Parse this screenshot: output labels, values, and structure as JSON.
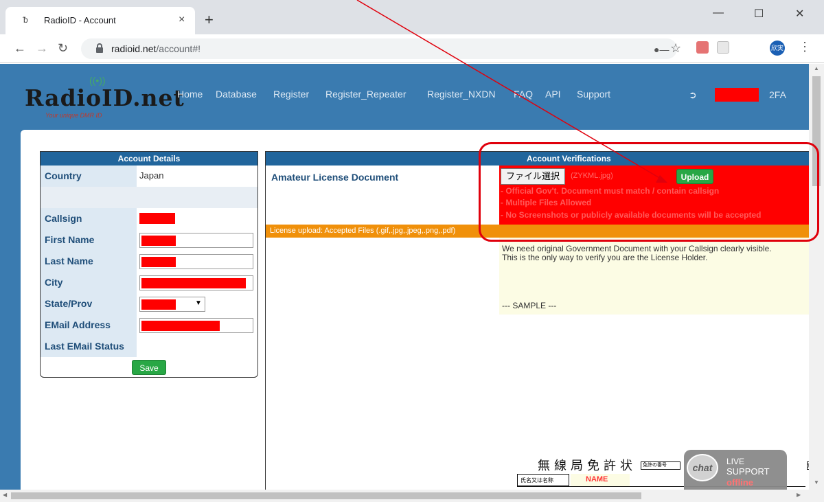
{
  "browser": {
    "tab_title": "RadioID - Account",
    "tab_close": "×",
    "new_tab": "+",
    "url_host": "radioid.net",
    "url_path": "/account#!",
    "avatar_text": "欣実",
    "window_controls": {
      "minimize": "—",
      "maximize": "☐",
      "close": "✕"
    }
  },
  "site": {
    "logo_text": "RadioID.net",
    "logo_tagline": "Your unique DMR ID",
    "nav": [
      "Home",
      "Database",
      "Register",
      "Register_Repeater",
      "Register_NXDN",
      "FAQ",
      "API",
      "Support"
    ],
    "twofa": "2FA"
  },
  "account_details": {
    "title": "Account Details",
    "rows": [
      {
        "label": "Country",
        "value": "Japan"
      },
      {
        "label": "",
        "value": ""
      },
      {
        "label": "Callsign",
        "value": ""
      },
      {
        "label": "First Name",
        "value": ""
      },
      {
        "label": "Last Name",
        "value": ""
      },
      {
        "label": "City",
        "value": ""
      },
      {
        "label": "State/Prov",
        "value": ""
      },
      {
        "label": "EMail Address",
        "value": ""
      },
      {
        "label": "Last EMail Status",
        "value": ""
      }
    ],
    "save_label": "Save"
  },
  "verifications": {
    "title": "Account Verifications",
    "doc_label": "Amateur License Document",
    "file_button": "ファイル選択",
    "file_none": "(ZYKML.jpg)",
    "upload_label": "Upload",
    "notes": [
      "- Official Gov't. Document must match / contain callsign",
      "- Multiple Files Allowed",
      "- No Screenshots or publicly available documents will be accepted"
    ],
    "accepted_files": "License upload: Accepted Files (.gif,.jpg,.jpeg,.png,.pdf)",
    "info_lines": [
      "We need original Government Document with your Callsign clearly visible.",
      "This is the only way to verify you are the License Holder."
    ],
    "sample_label": "--- SAMPLE ---",
    "sample_doc_title": "無線局免許状",
    "sample_doc_box": "免許の番号",
    "sample_doc_box2": "別信",
    "sample_name_label": "氏名又は名称",
    "sample_name_value": "NAME"
  },
  "chat_widget": {
    "bubble": "chat",
    "line1": "LIVE",
    "line2": "SUPPORT",
    "line3": "offline"
  },
  "colors": {
    "header_blue": "#3a7bb0",
    "panel_head_blue": "#21659c",
    "alert_red": "#ff0000",
    "accepted_orange": "#f0900a",
    "save_green": "#28a745"
  }
}
